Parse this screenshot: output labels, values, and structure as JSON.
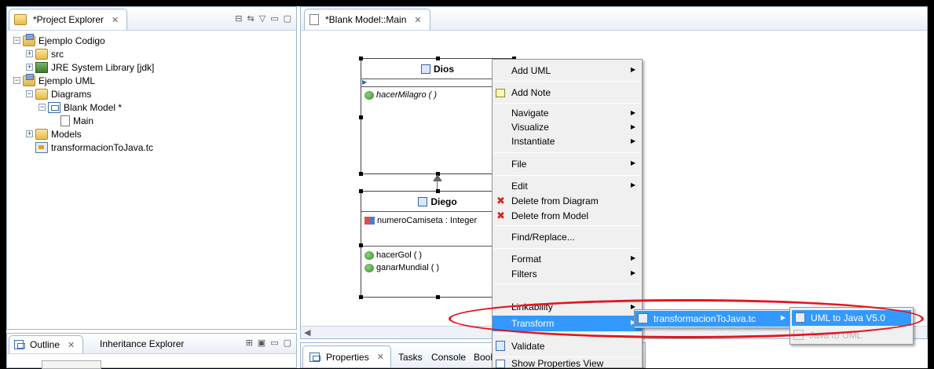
{
  "project_explorer": {
    "tab_label": "*Project Explorer",
    "tree": [
      {
        "label": "Ejemplo Codigo",
        "indent": 0,
        "expander": "−",
        "icon": "project-icon"
      },
      {
        "label": "src",
        "indent": 1,
        "expander": "+",
        "icon": "package-folder-icon"
      },
      {
        "label": "JRE System Library [jdk]",
        "indent": 1,
        "expander": "+",
        "icon": "library-icon"
      },
      {
        "label": "Ejemplo UML",
        "indent": 0,
        "expander": "−",
        "icon": "project-icon"
      },
      {
        "label": "Diagrams",
        "indent": 1,
        "expander": "−",
        "icon": "folder-icon"
      },
      {
        "label": "Blank Model *",
        "indent": 2,
        "expander": "−",
        "icon": "diagram-icon"
      },
      {
        "label": "Main",
        "indent": 3,
        "expander": "",
        "icon": "file-icon"
      },
      {
        "label": "Models",
        "indent": 1,
        "expander": "+",
        "icon": "folder-icon"
      },
      {
        "label": "transformacionToJava.tc",
        "indent": 1,
        "expander": "",
        "icon": "tc-file-icon"
      }
    ]
  },
  "outline": {
    "tab_label": "Outline",
    "second_tab_label": "Inheritance Explorer"
  },
  "editor": {
    "tab_label": "*Blank Model::Main"
  },
  "diagram": {
    "class_dios": {
      "name": "Dios",
      "operations": [
        "hacerMilagro ( )"
      ]
    },
    "class_diego": {
      "name": "Diego",
      "attributes": [
        "numeroCamiseta : Integer"
      ],
      "operations": [
        "hacerGol ( )",
        "ganarMundial ( )"
      ]
    }
  },
  "properties_bar": {
    "properties_label": "Properties",
    "tasks_label": "Tasks",
    "console_label": "Console",
    "bookmarks_label": "Bookma"
  },
  "context_menu": {
    "add_uml": "Add UML",
    "add_note": "Add Note",
    "navigate": "Navigate",
    "visualize": "Visualize",
    "instantiate": "Instantiate",
    "file": "File",
    "edit": "Edit",
    "delete_from_diagram": "Delete from Diagram",
    "delete_from_model": "Delete from Model",
    "find_replace": "Find/Replace...",
    "format": "Format",
    "filters": "Filters",
    "linkability": "Linkability",
    "transform": "Transform",
    "validate": "Validate",
    "show_properties_view": "Show Properties View"
  },
  "transform_submenu": {
    "item": "transformacionToJava.tc"
  },
  "transform_sub_submenu": {
    "item_uml_to_java": "UML to Java V5.0",
    "item_disabled": "Java to UML"
  },
  "colors": {
    "highlight": "#3399ff",
    "annotation_oval": "#e3161d",
    "view_border": "#9eb6ce"
  }
}
